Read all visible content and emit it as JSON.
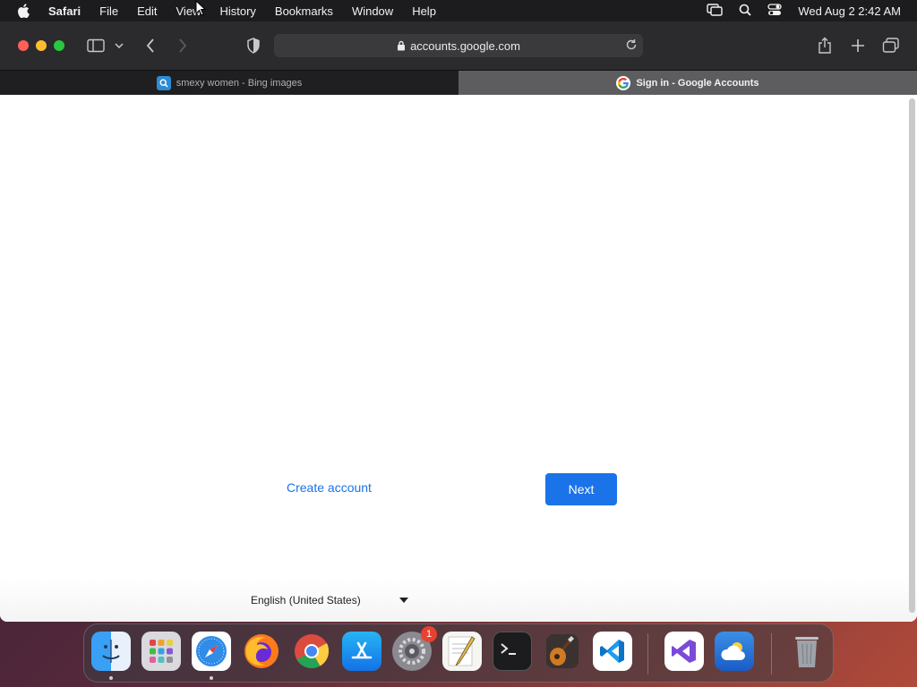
{
  "menubar": {
    "app_name": "Safari",
    "items": [
      "File",
      "Edit",
      "View",
      "History",
      "Bookmarks",
      "Window",
      "Help"
    ],
    "clock": "Wed Aug 2  2:42 AM",
    "status_icons": [
      "screen-mirroring-icon",
      "spotlight-search-icon",
      "control-center-icon"
    ]
  },
  "browser": {
    "address": "accounts.google.com",
    "tabs": [
      {
        "label": "smexy women - Bing images",
        "favicon": "bing-search-icon",
        "active": false
      },
      {
        "label": "Sign in - Google Accounts",
        "favicon": "google-icon",
        "active": true
      }
    ]
  },
  "page": {
    "create_account": "Create account",
    "next": "Next",
    "language": "English (United States)"
  },
  "dock": {
    "apps": [
      "Finder",
      "Launchpad",
      "Safari",
      "Firefox",
      "Google Chrome",
      "App Store",
      "System Settings",
      "TextEdit",
      "Terminal",
      "GarageBand",
      "Visual Studio Code",
      "Visual Studio",
      "Weather",
      "Trash"
    ],
    "system_settings_badge": "1"
  },
  "colors": {
    "accent": "#1a73e8",
    "menubar_bg": "#1c1c1e",
    "toolbar_bg": "#2b2b2d"
  }
}
